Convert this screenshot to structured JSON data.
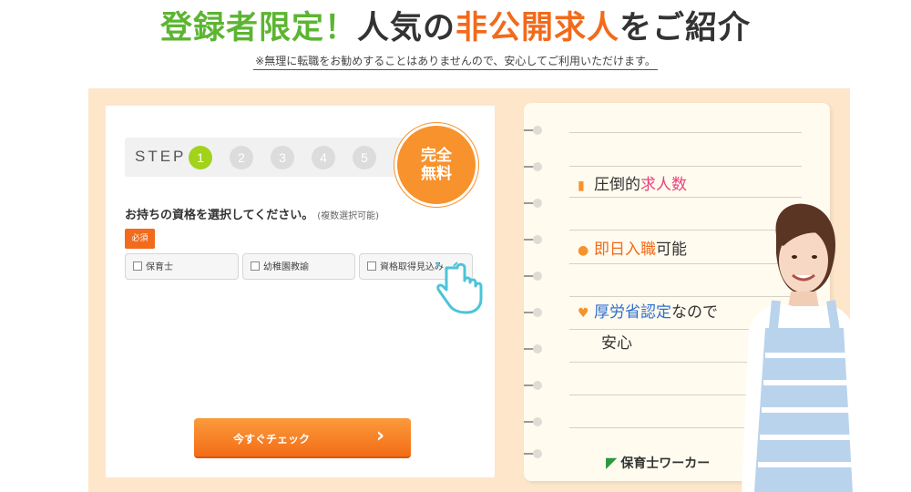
{
  "headline": {
    "part1": "登録者限定！",
    "part2": "人気の",
    "part3": "非公開求人",
    "part4": "をご紹介"
  },
  "subline": "※無理に転職をお勧めすることはありませんので、安心してご利用いただけます。",
  "form": {
    "step_label": "STEP",
    "steps": [
      "1",
      "2",
      "3",
      "4",
      "5"
    ],
    "current_step": 1,
    "badge_line1": "完全",
    "badge_line2": "無料",
    "question": "お持ちの資格を選択してください。",
    "question_note": "(複数選択可能)",
    "required": "必須",
    "options": [
      "保育士",
      "幼稚園教諭",
      "資格取得見込み"
    ],
    "cta_label": "今すぐチェック",
    "cta_arrow": "›"
  },
  "features": {
    "f1_icon": "document-icon",
    "f1_a": "圧倒的",
    "f1_b": "求人数",
    "f2_icon": "person-icon",
    "f2_a": "即日入職",
    "f2_b": "可能",
    "f3_icon": "heart-icon",
    "f3_a": "厚労省認定",
    "f3_b": "なので",
    "f3_c": "安心"
  },
  "logo": {
    "text": "保育士ワーカー"
  },
  "colors": {
    "green": "#5cb531",
    "orange": "#f26a1b",
    "cream": "#fde6c9",
    "step_active": "#a2d21b"
  }
}
